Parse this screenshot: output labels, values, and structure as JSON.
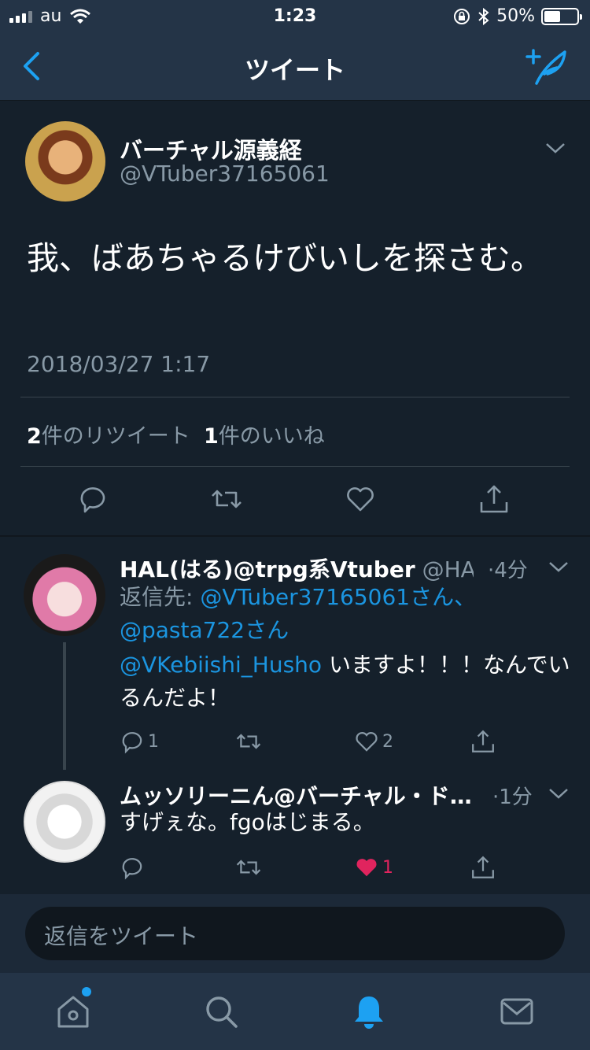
{
  "status_bar": {
    "carrier": "au",
    "time": "1:23",
    "battery": "50%",
    "battery_level": 0.5
  },
  "nav": {
    "title": "ツイート",
    "back_icon": "chevron-left-icon",
    "compose_icon": "compose-feather-icon"
  },
  "main_tweet": {
    "display_name": "バーチャル源義経",
    "handle": "@VTuber37165061",
    "text": "我、ばあちゃるけびいしを探さむ。",
    "timestamp": "2018/03/27 1:17",
    "retweet_count": "2",
    "retweet_label": "件のリツイート",
    "like_count": "1",
    "like_label": "件のいいね"
  },
  "replies": [
    {
      "display_name": "HAL(はる)@trpg系Vtuber",
      "handle": "@HA...",
      "time": "·4分",
      "reply_prefix": "返信先: ",
      "reply_to": "@VTuber37165061さん、@pasta722さん",
      "mention": "@VKebiishi_Husho",
      "text": " いますよ！！！なんでいるんだよ！",
      "reply_count": "1",
      "retweet_count": "",
      "like_count": "2"
    },
    {
      "display_name": "ムッソリーニん@バーチャル・ド…",
      "time": "·1分",
      "text": "すげぇな。fgoはじまる。",
      "reply_count": "",
      "retweet_count": "",
      "like_count": "1",
      "liked": true
    }
  ],
  "composer": {
    "placeholder": "返信をツイート"
  },
  "tabs": [
    "home-icon",
    "search-icon",
    "notifications-icon",
    "messages-icon"
  ],
  "colors": {
    "background": "#15202b",
    "bar": "#243447",
    "accent": "#1da1f2",
    "like": "#e0245e",
    "muted": "#8899a6"
  }
}
